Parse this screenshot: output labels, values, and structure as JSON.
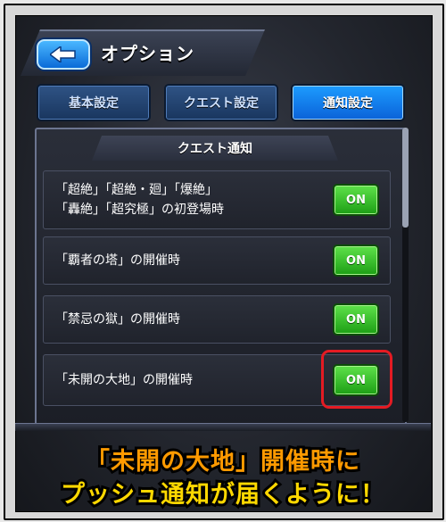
{
  "header": {
    "title": "オプション"
  },
  "tabs": [
    {
      "label": "基本設定",
      "active": false
    },
    {
      "label": "クエスト設定",
      "active": false
    },
    {
      "label": "通知設定",
      "active": true
    }
  ],
  "section": {
    "title": "クエスト通知"
  },
  "rows": [
    {
      "line1": "「超絶」「超絶・廻」「爆絶」",
      "line2": "「轟絶」「超究極」の初登場時",
      "toggle": "ON"
    },
    {
      "line1": "「覇者の塔」の開催時",
      "toggle": "ON"
    },
    {
      "line1": "「禁忌の獄」の開催時",
      "toggle": "ON"
    },
    {
      "line1": "「未開の大地」の開催時",
      "toggle": "ON"
    }
  ],
  "caption": {
    "line1": "「未開の大地」開催時に",
    "line2": "プッシュ通知が届くように！"
  },
  "colors": {
    "accent_blue": "#1d9cff",
    "toggle_green": "#2fbf22",
    "highlight_red": "#e41b23",
    "caption_orange": "#ff9a00",
    "caption_yellow": "#ffd800"
  }
}
